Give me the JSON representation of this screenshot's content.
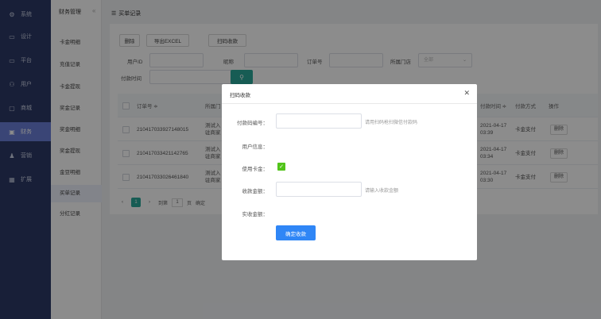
{
  "sidebar": {
    "items": [
      {
        "icon": "gear-icon",
        "glyph": "⚙",
        "label": "系统"
      },
      {
        "icon": "monitor-icon",
        "glyph": "▭",
        "label": "设计"
      },
      {
        "icon": "platform-icon",
        "glyph": "▭",
        "label": "平台"
      },
      {
        "icon": "user-icon",
        "glyph": "⚇",
        "label": "用户"
      },
      {
        "icon": "shop-icon",
        "glyph": "▢",
        "label": "商城"
      },
      {
        "icon": "finance-icon",
        "glyph": "▣",
        "label": "财务"
      },
      {
        "icon": "marketing-icon",
        "glyph": "♟",
        "label": "营销"
      },
      {
        "icon": "extension-icon",
        "glyph": "▦",
        "label": "扩展"
      }
    ]
  },
  "subnav": {
    "title": "财务管理",
    "collapse": "«",
    "items": [
      "卡金明细",
      "充值记录",
      "卡金提现",
      "奖金记录",
      "奖金明细",
      "奖金提现",
      "金豆明细",
      "买单记录",
      "分红记录"
    ]
  },
  "main": {
    "title_icon": "☰",
    "title": "买单记录",
    "toolbar": {
      "delete": "删除",
      "export": "导出EXCEL",
      "scan": "扫码收款"
    },
    "filters": {
      "user_id": "用户ID",
      "nickname": "昵称",
      "order_no": "订单号",
      "store": "所属门店",
      "store_placeholder": "全部",
      "pay_time": "付款时间",
      "search_glyph": "⚲"
    },
    "table": {
      "headers": {
        "order_no": "订单号 ≑",
        "store": "所属门",
        "pay_time": "付款时间 ≑",
        "pay_method": "付款方式",
        "action": "操作"
      },
      "rows": [
        {
          "order_no": "210417033927148015",
          "store": "测试入驻商家",
          "pay_time": "2021-04-17 03:39",
          "pay_method": "卡金支付",
          "action": "删除"
        },
        {
          "order_no": "210417033421142765",
          "store": "测试入驻商家",
          "pay_time": "2021-04-17 03:34",
          "pay_method": "卡金支付",
          "action": "删除"
        },
        {
          "order_no": "210417033026461840",
          "store": "测试入驻商家",
          "pay_time": "2021-04-17 03:30",
          "pay_method": "卡金支付",
          "action": "删除"
        }
      ]
    },
    "pager": {
      "prev": "‹",
      "current": "1",
      "next": "›",
      "goto": "到第",
      "page_value": "1",
      "page_unit": "页",
      "confirm": "确定"
    }
  },
  "modal": {
    "title": "扫码收款",
    "close": "✕",
    "code_label": "付款码编号：",
    "code_hint": "请用扫码枪扫微信付款码",
    "user_info_label": "用户信息：",
    "use_card_label": "使用卡金：",
    "amount_label": "收款金额：",
    "amount_hint": "请输入收款金额",
    "actual_label": "实收金额：",
    "confirm": "确定收款"
  },
  "colors": {
    "sidebar_bg": "#2d3a66",
    "sidebar_active": "#6b7fd8",
    "accent_teal": "#2aa89a",
    "primary_blue": "#2f86f6",
    "check_green": "#52c41a"
  }
}
